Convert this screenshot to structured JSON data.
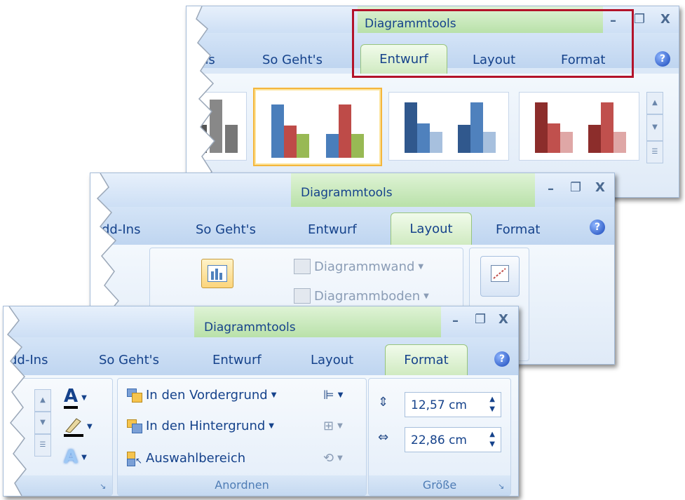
{
  "context_label": "Diagrammtools",
  "help_glyph": "?",
  "win_controls": {
    "minimize": "–",
    "restore": "❐",
    "close": "X"
  },
  "panel1": {
    "tabs": {
      "partial": "ns",
      "sogehts": "So Geht's",
      "entwurf": "Entwurf",
      "layout": "Layout",
      "format": "Format"
    },
    "active_tab": "Entwurf",
    "styles_gallery": [
      "gray-style",
      "colorful-style",
      "blue-style",
      "red-style"
    ]
  },
  "panel2": {
    "tabs": {
      "partial": "dd-Ins",
      "sogehts": "So Geht's",
      "entwurf": "Entwurf",
      "layout": "Layout",
      "format": "Format"
    },
    "active_tab": "Layout",
    "commands": {
      "wall": "Diagrammwand",
      "floor": "Diagrammboden"
    }
  },
  "panel3": {
    "tabs": {
      "partial": "dd-Ins",
      "sogehts": "So Geht's",
      "entwurf": "Entwurf",
      "layout": "Layout",
      "format": "Format"
    },
    "active_tab": "Format",
    "arrange": {
      "label": "Anordnen",
      "bring_front": "In den Vordergrund",
      "send_back": "In den Hintergrund",
      "selection_pane": "Auswahlbereich"
    },
    "size": {
      "label": "Größe",
      "height": "12,57 cm",
      "width": "22,86 cm"
    },
    "wordart": {
      "text_glyph": "A",
      "fill_glyph": "A"
    }
  },
  "colors": {
    "ribbon_blue": "#bfd5f0",
    "context_green": "#b9e1a9",
    "highlight_red": "#b3132a",
    "selected_gold": "#f4b63c",
    "text_blue": "#15428b"
  }
}
